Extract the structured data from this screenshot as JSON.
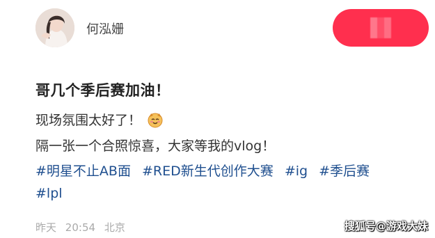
{
  "post": {
    "author": {
      "name": "何泓姗",
      "avatar_icon": "user-avatar"
    },
    "follow_button": {
      "icon": "blurred-label",
      "color": "#ff2f4e"
    },
    "title": "哥几个季后赛加油！",
    "body_line1": "现场氛围太好了！",
    "body_line1_emoji": "smiling-face-icon",
    "body_line2": "隔一张一个合照惊喜，大家等我的vlog！",
    "hashtags": [
      "#明星不止AB面",
      "#RED新生代创作大赛",
      "#ig",
      "#季后赛",
      "#lpl"
    ],
    "hashtag_color": "#1f4f8f",
    "meta": {
      "day": "昨天",
      "time": "20:54",
      "location": "北京"
    }
  },
  "watermark": "搜狐号@游戏大妹"
}
